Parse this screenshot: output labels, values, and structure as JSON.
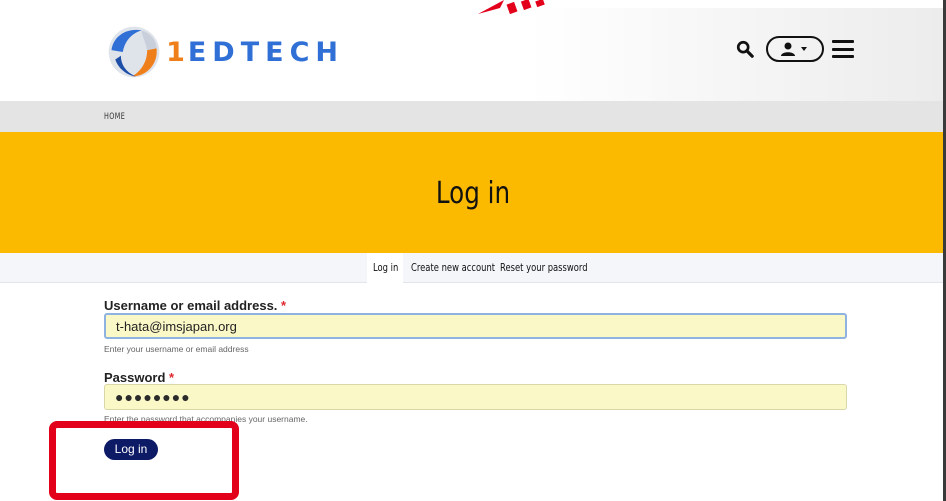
{
  "header": {
    "logo_number": "1",
    "logo_text": "EDTECH",
    "search_icon": "search-icon",
    "user_icon": "user-dropdown-icon",
    "menu_icon": "hamburger-menu-icon"
  },
  "breadcrumb": {
    "home": "HOME"
  },
  "banner": {
    "title": "Log in"
  },
  "tabs": [
    {
      "label": "Log in",
      "active": true
    },
    {
      "label": "Create new account",
      "active": false
    },
    {
      "label": "Reset your password",
      "active": false
    }
  ],
  "form": {
    "username": {
      "label": "Username or email address.",
      "required_mark": "*",
      "value": "t-hata@imsjapan.org",
      "description": "Enter your username or email address"
    },
    "password": {
      "label": "Password",
      "required_mark": "*",
      "masked_value": "●●●●●●●●",
      "description": "Enter the password that accompanies your username."
    },
    "submit_label": "Log in"
  },
  "colors": {
    "banner": "#fbba00",
    "primary_button": "#0d1a66",
    "highlight": "#e3001b",
    "brand_blue": "#2f6fd6",
    "brand_orange": "#ef7f1a"
  }
}
